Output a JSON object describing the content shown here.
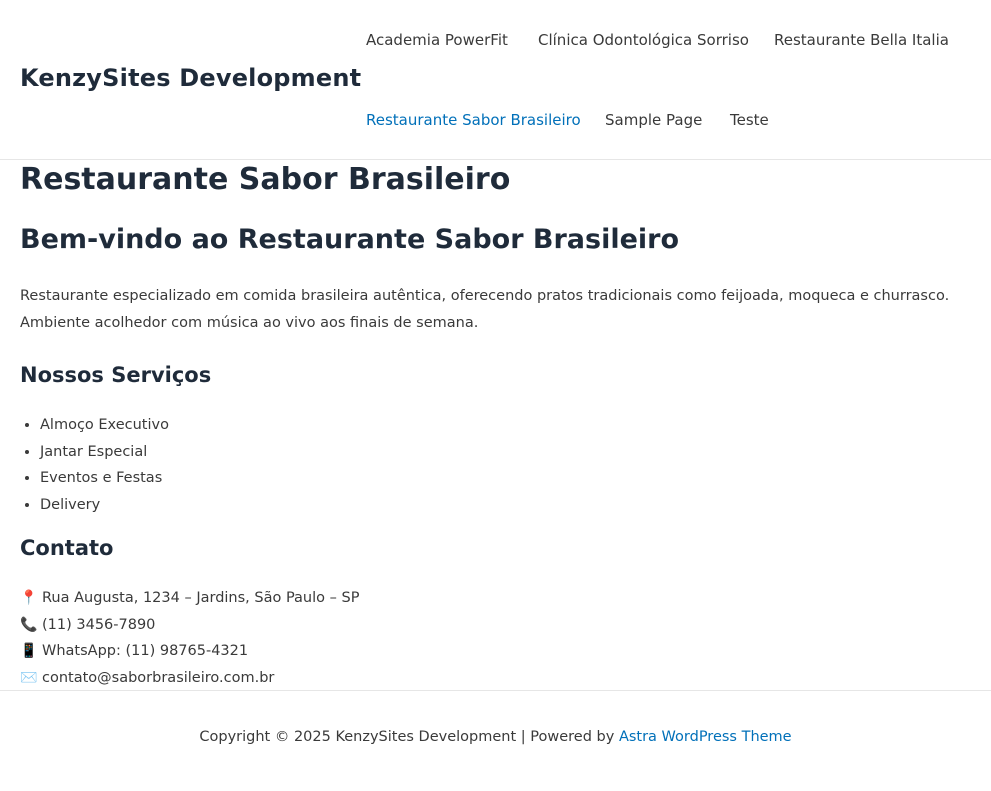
{
  "site": {
    "title": "KenzySites Development"
  },
  "nav": {
    "items": [
      {
        "label": "Academia PowerFit"
      },
      {
        "label": "Clínica Odontológica Sorriso"
      },
      {
        "label": "Restaurante Bella Italia"
      },
      {
        "label": "Restaurante Sabor Brasileiro",
        "active": true
      },
      {
        "label": "Sample Page"
      },
      {
        "label": "Teste"
      }
    ]
  },
  "page": {
    "title": "Restaurante Sabor Brasileiro",
    "welcome_heading": "Bem-vindo ao Restaurante Sabor Brasileiro",
    "intro_line1": "Restaurante especializado em comida brasileira autêntica, oferecendo pratos tradicionais como feijoada, moqueca e churrasco.",
    "intro_line2": "Ambiente acolhedor com música ao vivo aos finais de semana.",
    "services_heading": "Nossos Serviços",
    "services": [
      "Almoço Executivo",
      "Jantar Especial",
      "Eventos e Festas",
      "Delivery"
    ],
    "contact_heading": "Contato",
    "contact": [
      {
        "icon": "📍",
        "icon_name": "pin-icon",
        "text": "Rua Augusta, 1234 – Jardins, São Paulo – SP"
      },
      {
        "icon": "📞",
        "icon_name": "phone-icon",
        "text": "(11) 3456-7890"
      },
      {
        "icon": "📱",
        "icon_name": "mobile-icon",
        "text": "WhatsApp: (11) 98765-4321"
      },
      {
        "icon": "✉️",
        "icon_name": "envelope-icon",
        "text": "contato@saborbrasileiro.com.br"
      }
    ]
  },
  "footer": {
    "prefix": "Copyright © 2025 KenzySites Development | Powered by",
    "link_label": "Astra WordPress Theme"
  },
  "colors": {
    "accent": "#0170b9",
    "heading": "#1f2b3a",
    "text": "#3a3a3a",
    "divider": "#e6e6e6"
  }
}
